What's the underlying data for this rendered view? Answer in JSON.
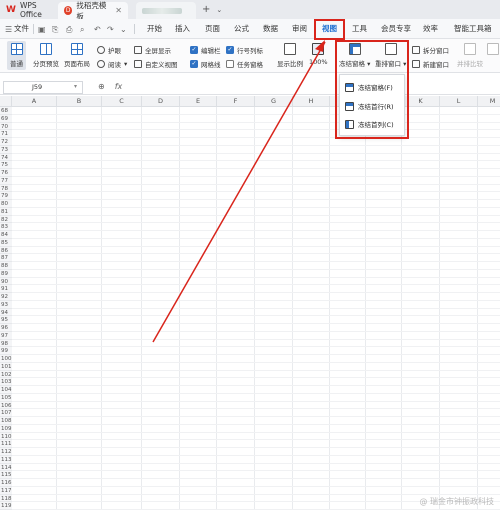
{
  "titlebar": {
    "app_tab": "WPS Office",
    "doc_tab": "找稻壳模板",
    "doc_close": "✕",
    "new_tab": "+",
    "dropdown_arrow": "⌄"
  },
  "menubar": {
    "file": "文件",
    "items": [
      "开始",
      "插入",
      "页面",
      "公式",
      "数据",
      "审阅",
      "视图",
      "工具",
      "会员专享",
      "效率",
      "智能工具箱"
    ],
    "active": "视图"
  },
  "ribbon": {
    "normal": "普通",
    "page_break_preview": "分页预览",
    "page_layout": "页面布局",
    "protect": "护眼",
    "reading": "阅读",
    "full_screen": "全屏显示",
    "custom_view": "自定义视图",
    "edit_bar": "编辑栏",
    "gridlines": "网格线",
    "row_col_headers": "行号列标",
    "task_pane": "任务窗格",
    "zoom_ratio": "显示比例",
    "zoom_100": "100%",
    "freeze_panes": "冻结窗格",
    "arrange_windows": "重排窗口",
    "split_window": "拆分窗口",
    "new_window": "新建窗口",
    "side_by_side": "并排比较"
  },
  "checkboxes": {
    "edit_bar": true,
    "gridlines": true,
    "row_col_headers": true,
    "task_pane": false
  },
  "formulabar": {
    "cell_ref": "J59",
    "fx": "fx"
  },
  "sheet": {
    "columns": [
      "A",
      "B",
      "C",
      "D",
      "E",
      "F",
      "G",
      "H",
      "I",
      "J",
      "K",
      "L",
      "M"
    ],
    "rows": [
      "68",
      "69",
      "70",
      "71",
      "72",
      "73",
      "74",
      "75",
      "76",
      "77",
      "78",
      "79",
      "80",
      "81",
      "82",
      "83",
      "84",
      "85",
      "86",
      "87",
      "88",
      "89",
      "90",
      "91",
      "92",
      "93",
      "94",
      "95",
      "96",
      "97",
      "98",
      "99",
      "100",
      "101",
      "102",
      "103",
      "104",
      "105",
      "106",
      "107",
      "108",
      "109",
      "110",
      "111",
      "112",
      "113",
      "114",
      "115",
      "116",
      "117",
      "118",
      "119"
    ]
  },
  "freeze_menu": {
    "items": [
      "冻结窗格(F)",
      "冻结首行(R)",
      "冻结首列(C)"
    ]
  },
  "watermark": "@ 瑞金市钟振政科技",
  "colors": {
    "highlight": "#d9251c",
    "accent": "#2f72c4"
  }
}
